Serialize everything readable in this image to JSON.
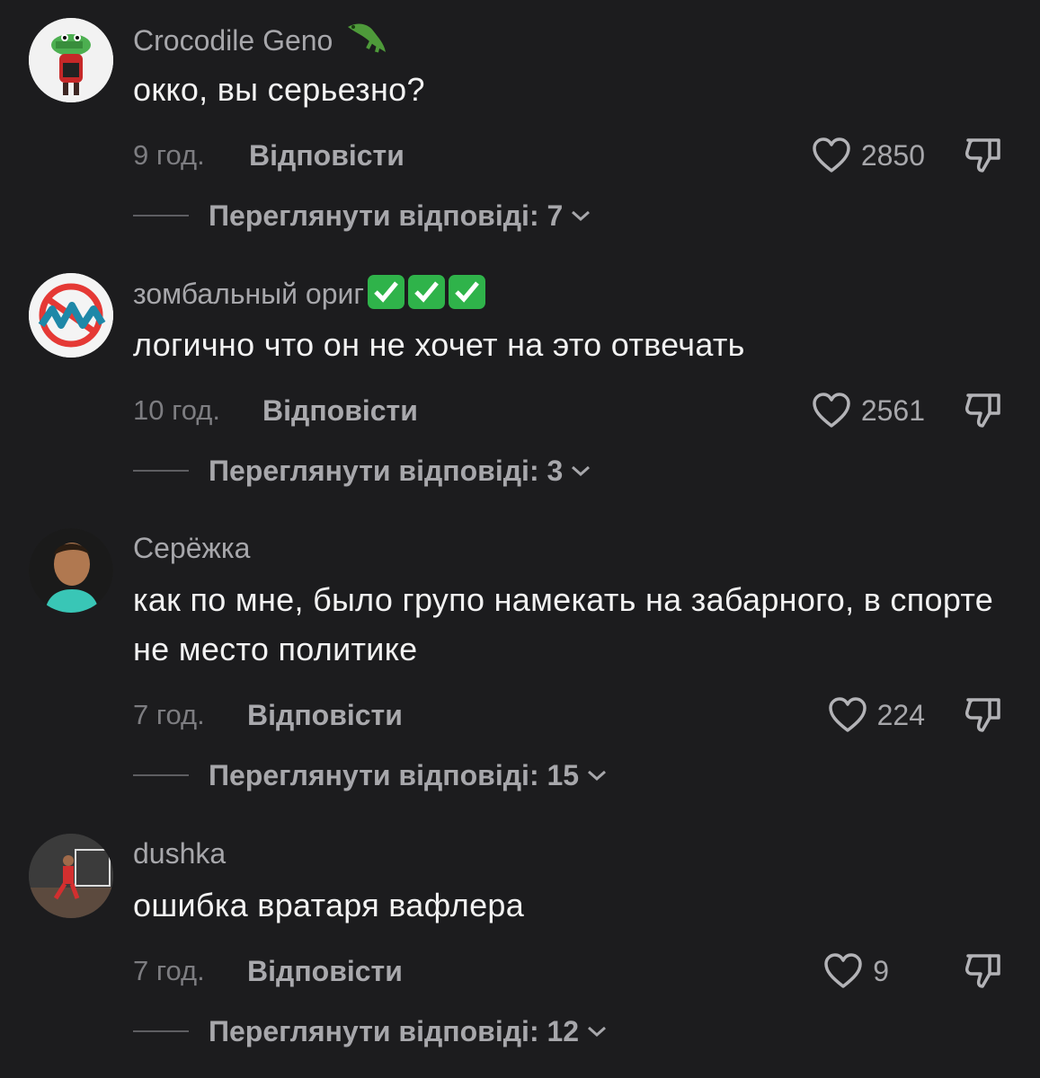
{
  "comments": [
    {
      "username": "Crocodile Geno",
      "username_suffix_icon": "crocodile-icon",
      "text": "окко, вы серьезно?",
      "time": "9 год.",
      "reply_label": "Відповісти",
      "likes": "2850",
      "view_replies": "Переглянути відповіді: 7"
    },
    {
      "username": "зомбальный ориг",
      "username_suffix_icon": "check-mark-button-icon x3",
      "text": "логично что он не хочет на это отвечать",
      "time": "10 год.",
      "reply_label": "Відповісти",
      "likes": "2561",
      "view_replies": "Переглянути відповіді: 3"
    },
    {
      "username": "Серёжка",
      "text": "как по мне, было групо намекать на забарного, в спорте не место политике",
      "time": "7 год.",
      "reply_label": "Відповісти",
      "likes": "224",
      "view_replies": "Переглянути відповіді: 15"
    },
    {
      "username": "dushka",
      "text": "ошибка вратаря вафлера",
      "time": "7 год.",
      "reply_label": "Відповісти",
      "likes": "9",
      "view_replies": "Переглянути відповіді: 12"
    }
  ],
  "colors": {
    "background": "#1c1c1e",
    "text_primary": "#f2f2f2",
    "text_secondary": "#a7a7ab",
    "check_green": "#2fb34a"
  }
}
